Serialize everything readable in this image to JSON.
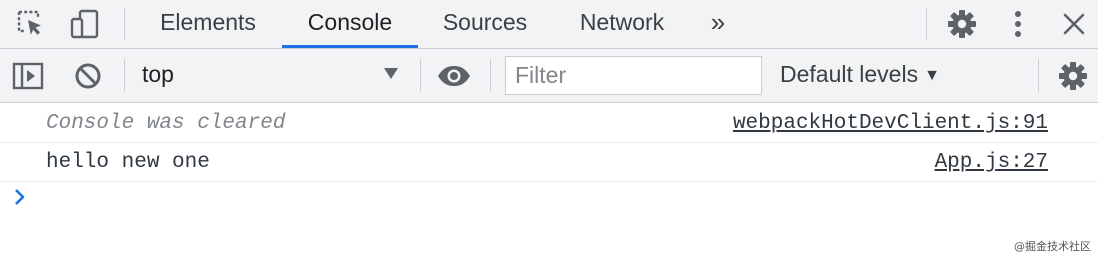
{
  "tabs": [
    {
      "label": "Elements"
    },
    {
      "label": "Console",
      "active": true
    },
    {
      "label": "Sources"
    },
    {
      "label": "Network"
    }
  ],
  "tab_overflow": "»",
  "toolbar": {
    "context": "top",
    "filter_placeholder": "Filter",
    "levels": "Default levels"
  },
  "messages": [
    {
      "text": "Console was cleared",
      "source": "webpackHotDevClient.js:91",
      "style": "muted"
    },
    {
      "text": "hello new one",
      "source": "App.js:27",
      "style": "log"
    }
  ],
  "watermark": "@掘金技术社区",
  "colors": {
    "accent": "#1a73e8",
    "panel": "#f1f3f4"
  },
  "icons": [
    "inspect-element-icon",
    "device-toggle-icon",
    "settings-icon",
    "more-vert-icon",
    "close-icon",
    "sidebar-toggle-icon",
    "clear-console-icon",
    "dropdown-arrow-icon",
    "eye-icon",
    "console-prompt-icon"
  ]
}
